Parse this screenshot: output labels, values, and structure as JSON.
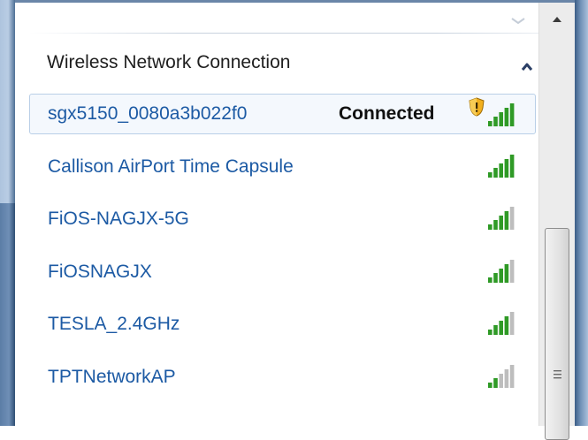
{
  "section": {
    "title": "Wireless Network Connection",
    "collapse_icon": "chevron-up-icon"
  },
  "networks": [
    {
      "name": "sgx5150_0080a3b022f0",
      "status": "Connected",
      "selected": true,
      "secured_shield": true,
      "signal_bars": 5
    },
    {
      "name": "Callison AirPort Time Capsule",
      "status": "",
      "selected": false,
      "signal_bars": 5
    },
    {
      "name": "FiOS-NAGJX-5G",
      "status": "",
      "selected": false,
      "signal_bars": 4
    },
    {
      "name": "FiOSNAGJX",
      "status": "",
      "selected": false,
      "signal_bars": 4
    },
    {
      "name": "TESLA_2.4GHz",
      "status": "",
      "selected": false,
      "signal_bars": 4
    },
    {
      "name": "TPTNetworkAP",
      "status": "",
      "selected": false,
      "signal_bars": 2
    }
  ],
  "colors": {
    "network_name": "#1c5aa4",
    "signal_on": "#2f9a26",
    "signal_off": "#bdbdbd",
    "selected_bg": "#f4f8fd",
    "selected_border": "#b9cfe7"
  },
  "icons": {
    "signal": "signal-strength-icon",
    "shield": "security-shield-icon",
    "scroll_up": "scroll-up-arrow-icon",
    "grip": "scrollbar-grip-icon"
  }
}
